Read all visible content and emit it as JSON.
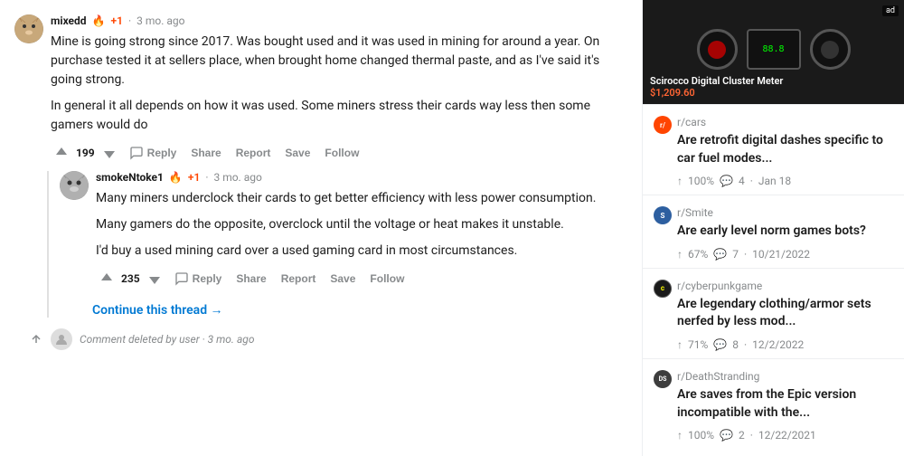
{
  "comments": [
    {
      "id": "comment-1",
      "username": "mixedd",
      "karma": "+1",
      "time": "3 mo. ago",
      "avatar_emoji": "🐱",
      "text_paragraphs": [
        "Mine is going strong since 2017. Was bought used and it was used in mining for around a year. On purchase tested it at sellers place, when brought home changed thermal paste, and as I've said it's going strong.",
        "In general it all depends on how it was used. Some miners stress their cards way less then some gamers would do"
      ],
      "vote_count": "199",
      "actions": [
        "Reply",
        "Share",
        "Report",
        "Save",
        "Follow"
      ]
    },
    {
      "id": "comment-2",
      "username": "smokeNtoke1",
      "karma": "+1",
      "time": "3 mo. ago",
      "avatar_emoji": "🐭",
      "text_paragraphs": [
        "Many miners underclock their cards to get better efficiency with less power consumption.",
        "Many gamers do the opposite, overclock until the voltage or heat makes it unstable.",
        "I'd buy a used mining card over a used gaming card in most circumstances."
      ],
      "vote_count": "235",
      "actions": [
        "Reply",
        "Share",
        "Report",
        "Save",
        "Follow"
      ]
    }
  ],
  "continue_thread": "Continue this thread →",
  "deleted_comment": "Comment deleted by user · 3 mo. ago",
  "sidebar": {
    "product": {
      "name": "Scirocco Digital Cluster Meter",
      "price": "$1,209.60"
    },
    "posts": [
      {
        "id": "post-1",
        "subreddit": "r/cars",
        "subreddit_color": "#ff4500",
        "title": "Are retrofit digital dashes specific to car fuel modes...",
        "score": "100%",
        "comments": "4",
        "date": "Jan 18"
      },
      {
        "id": "post-2",
        "subreddit": "r/Smite",
        "subreddit_color": "#2d5fa0",
        "subreddit_initial": "r/S",
        "title": "Are early level norm games bots?",
        "score": "67%",
        "comments": "7",
        "date": "10/21/2022"
      },
      {
        "id": "post-3",
        "subreddit": "r/cyberpunkgame",
        "subreddit_color": "#1a1a1a",
        "subreddit_initial": "r/c",
        "title": "Are legendary clothing/armor sets nerfed by less mod...",
        "score": "71%",
        "comments": "8",
        "date": "12/2/2022"
      },
      {
        "id": "post-4",
        "subreddit": "r/DeathStranding",
        "subreddit_color": "#3d3d3d",
        "subreddit_initial": "DS",
        "title": "Are saves from the Epic version incompatible with the...",
        "score": "100%",
        "comments": "2",
        "date": "12/22/2021"
      }
    ]
  },
  "labels": {
    "continue_thread": "Continue this thread →",
    "reply": "Reply",
    "share": "Share",
    "report": "Report",
    "save": "Save",
    "follow": "Follow"
  }
}
